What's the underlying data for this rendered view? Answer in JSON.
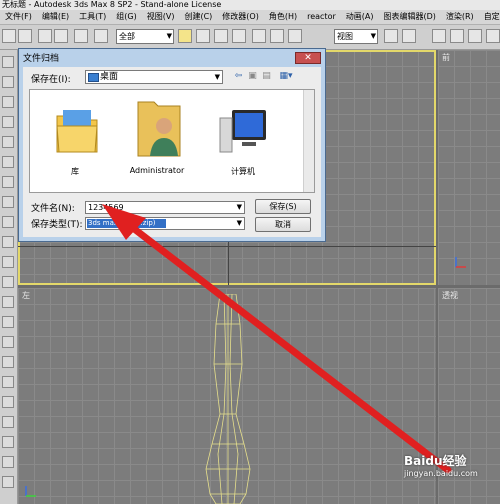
{
  "window": {
    "title": "无标题 - Autodesk 3ds Max 8 SP2 - Stand-alone License"
  },
  "menu": [
    "文件(F)",
    "编辑(E)",
    "工具(T)",
    "组(G)",
    "视图(V)",
    "创建(C)",
    "修改器(O)",
    "角色(H)",
    "reactor",
    "动画(A)",
    "图表编辑器(D)",
    "渲染(R)",
    "自定义(U)"
  ],
  "toolbar": {
    "filter_value": "全部",
    "view_value": "视图"
  },
  "viewports": {
    "top_right_label": "前",
    "bottom_left_label": "左",
    "bottom_right_label": "透视"
  },
  "dialog": {
    "title": "文件归档",
    "close_label": "✕",
    "save_in_label": "保存在(I):",
    "save_in_value": "桌面",
    "items": [
      {
        "label": "库"
      },
      {
        "label": "Administrator"
      },
      {
        "label": "计算机"
      }
    ],
    "filename_label": "文件名(N):",
    "filename_value": "1234569",
    "filetype_label": "保存类型(T):",
    "filetype_value": "3ds max 归档(*.zip)",
    "save_button": "保存(S)",
    "cancel_button": "取消"
  },
  "watermark": {
    "brand": "Baidu经验",
    "url": "jingyan.baidu.com"
  },
  "colors": {
    "accent_arrow": "#e02020",
    "active_viewport": "#e3d86a",
    "selection": "#3370c6"
  }
}
